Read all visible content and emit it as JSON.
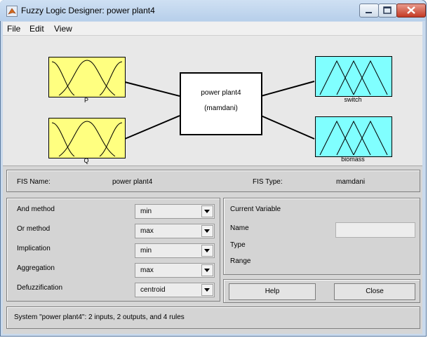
{
  "window": {
    "title": "Fuzzy Logic Designer: power plant4"
  },
  "menu": {
    "items": [
      "File",
      "Edit",
      "View"
    ]
  },
  "diagram": {
    "inputs": [
      {
        "name": "P"
      },
      {
        "name": "Q"
      }
    ],
    "outputs": [
      {
        "name": "switch"
      },
      {
        "name": "biomass"
      }
    ],
    "system": {
      "name": "power plant4",
      "type_label": "(mamdani)"
    },
    "colors": {
      "input": "#ffff80",
      "output": "#80ffff"
    }
  },
  "fis_info": {
    "name_label": "FIS Name:",
    "name_value": "power plant4",
    "type_label": "FIS Type:",
    "type_value": "mamdani"
  },
  "methods": {
    "and_method": {
      "label": "And method",
      "value": "min"
    },
    "or_method": {
      "label": "Or method",
      "value": "max"
    },
    "implication": {
      "label": "Implication",
      "value": "min"
    },
    "aggregation": {
      "label": "Aggregation",
      "value": "max"
    },
    "defuzzification": {
      "label": "Defuzzification",
      "value": "centroid"
    }
  },
  "current_variable": {
    "heading": "Current Variable",
    "name_label": "Name",
    "type_label": "Type",
    "range_label": "Range",
    "name_value": ""
  },
  "buttons": {
    "help": "Help",
    "close": "Close"
  },
  "status": {
    "text": "System \"power plant4\": 2 inputs, 2 outputs, and 4 rules"
  }
}
